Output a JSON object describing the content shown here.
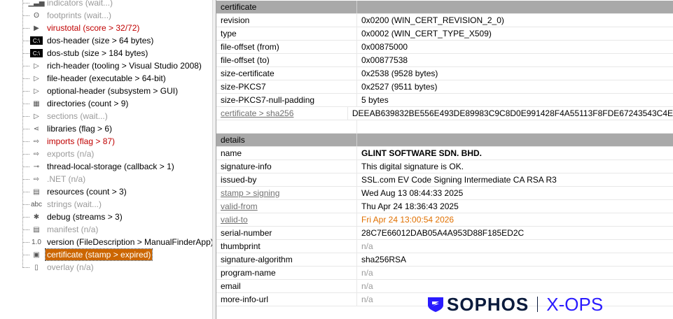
{
  "tree": [
    {
      "label": "indicators (wait...)",
      "style": "grey",
      "icon": "bar-chart-icon"
    },
    {
      "label": "footprints (wait...)",
      "style": "grey",
      "icon": "footprints-icon"
    },
    {
      "label": "virustotal (score > 32/72)",
      "style": "red",
      "icon": "virustotal-icon"
    },
    {
      "label": "dos-header (size > 64 bytes)",
      "style": "",
      "icon": "console-icon"
    },
    {
      "label": "dos-stub (size > 184 bytes)",
      "style": "",
      "icon": "console-icon"
    },
    {
      "label": "rich-header (tooling > Visual Studio 2008)",
      "style": "",
      "icon": "triangle-icon"
    },
    {
      "label": "file-header (executable > 64-bit)",
      "style": "",
      "icon": "triangle-icon"
    },
    {
      "label": "optional-header (subsystem > GUI)",
      "style": "",
      "icon": "triangle-icon"
    },
    {
      "label": "directories (count > 9)",
      "style": "",
      "icon": "table-icon"
    },
    {
      "label": "sections (wait...)",
      "style": "grey",
      "icon": "triangle-icon"
    },
    {
      "label": "libraries (flag > 6)",
      "style": "",
      "icon": "share-icon"
    },
    {
      "label": "imports (flag > 87)",
      "style": "red",
      "icon": "import-icon"
    },
    {
      "label": "exports (n/a)",
      "style": "grey",
      "icon": "export-icon"
    },
    {
      "label": "thread-local-storage (callback > 1)",
      "style": "",
      "icon": "key-icon"
    },
    {
      "label": ".NET (n/a)",
      "style": "grey",
      "icon": "export-icon"
    },
    {
      "label": "resources (count > 3)",
      "style": "",
      "icon": "resources-icon"
    },
    {
      "label": "strings (wait...)",
      "style": "grey",
      "icon": "abc-icon"
    },
    {
      "label": "debug (streams > 3)",
      "style": "",
      "icon": "bug-icon"
    },
    {
      "label": "manifest (n/a)",
      "style": "grey",
      "icon": "manifest-icon"
    },
    {
      "label": "version (FileDescription > ManualFinderApp)",
      "style": "",
      "icon": "version-icon"
    },
    {
      "label": "certificate (stamp > expired)",
      "style": "sel",
      "icon": "certificate-icon"
    },
    {
      "label": "overlay (n/a)",
      "style": "grey",
      "icon": "file-icon"
    }
  ],
  "icon_glyphs": {
    "bar-chart-icon": "▁▃▅",
    "footprints-icon": "ʘ",
    "virustotal-icon": "▶",
    "console-icon": "C:\\",
    "triangle-icon": "▷",
    "table-icon": "▦",
    "share-icon": "⋖",
    "import-icon": "⇨",
    "export-icon": "⇨",
    "key-icon": "⊸",
    "resources-icon": "▤",
    "abc-icon": "abc",
    "bug-icon": "✱",
    "manifest-icon": "▤",
    "version-icon": "1.0",
    "certificate-icon": "▣",
    "file-icon": "▯"
  },
  "certificate": {
    "header": "certificate",
    "rows": [
      {
        "k": "revision",
        "v": "0x0200 (WIN_CERT_REVISION_2_0)"
      },
      {
        "k": "type",
        "v": "0x0002 (WIN_CERT_TYPE_X509)"
      },
      {
        "k": "file-offset (from)",
        "v": "0x00875000"
      },
      {
        "k": "file-offset (to)",
        "v": "0x00877538"
      },
      {
        "k": "size-certificate",
        "v": "0x2538 (9528 bytes)"
      },
      {
        "k": "size-PKCS7",
        "v": "0x2527 (9511 bytes)"
      },
      {
        "k": "size-PKCS7-null-padding",
        "v": "5 bytes"
      },
      {
        "k": "certificate > sha256",
        "v": "DEEAB639832BE556E493DE89983C9C8D0E991428F4A55113F8FDE67243543C4E",
        "kstyle": "link"
      }
    ]
  },
  "details": {
    "header": "details",
    "rows": [
      {
        "k": "name",
        "v": "GLINT SOFTWARE SDN. BHD.",
        "vstyle": "bold"
      },
      {
        "k": "signature-info",
        "v": "This digital signature is OK."
      },
      {
        "k": "issued-by",
        "v": "SSL.com EV Code Signing Intermediate CA RSA R3"
      },
      {
        "k": "stamp > signing",
        "v": "Wed Aug 13 08:44:33 2025",
        "kstyle": "link"
      },
      {
        "k": "valid-from",
        "v": "Thu Apr 24 18:36:43 2025",
        "kstyle": "link"
      },
      {
        "k": "valid-to",
        "v": "Fri Apr 24 13:00:54 2026",
        "kstyle": "link",
        "vstyle": "orange"
      },
      {
        "k": "serial-number",
        "v": "28C7E66012DAB05A4A953D88F185ED2C"
      },
      {
        "k": "thumbprint",
        "v": "n/a",
        "vstyle": "grey"
      },
      {
        "k": "signature-algorithm",
        "v": "sha256RSA"
      },
      {
        "k": "program-name",
        "v": "n/a",
        "vstyle": "grey"
      },
      {
        "k": "email",
        "v": "n/a",
        "vstyle": "grey"
      },
      {
        "k": "more-info-url",
        "v": "n/a",
        "vstyle": "grey"
      }
    ]
  },
  "logo": {
    "brand": "SOPHOS",
    "product": "X-OPS"
  }
}
